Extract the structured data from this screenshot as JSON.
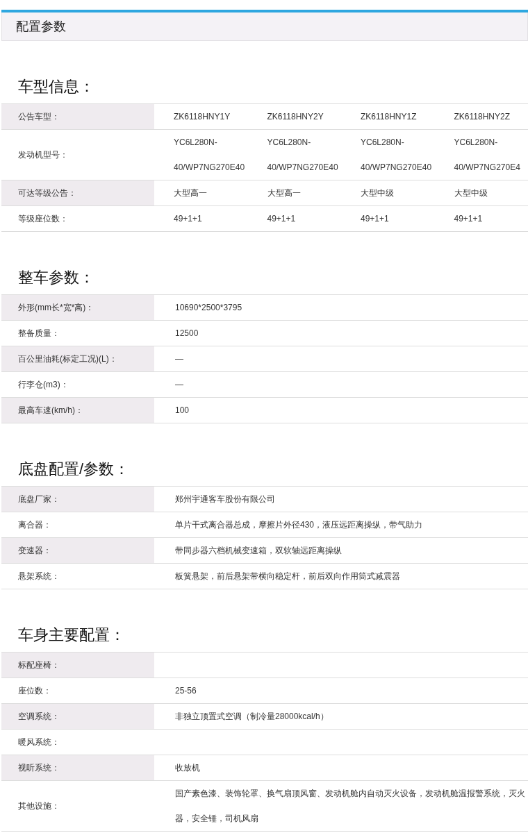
{
  "header": {
    "title": "配置参数"
  },
  "sections": [
    {
      "title": "车型信息：",
      "rows": [
        {
          "label": "公告车型：",
          "values": [
            "ZK6118HNY1Y",
            "ZK6118HNY2Y",
            "ZK6118HNY1Z",
            "ZK6118HNY2Z"
          ]
        },
        {
          "label": "发动机型号：",
          "values": [
            "YC6L280N-40/WP7NG270E40",
            "YC6L280N-40/WP7NG270E40",
            "YC6L280N-40/WP7NG270E40",
            "YC6L280N-40/WP7NG270E4"
          ]
        },
        {
          "label": "可达等级公告：",
          "values": [
            "大型高一",
            "大型高一",
            "大型中级",
            "大型中级"
          ]
        },
        {
          "label": "等级座位数：",
          "values": [
            "49+1+1",
            "49+1+1",
            "49+1+1",
            "49+1+1"
          ]
        }
      ]
    },
    {
      "title": "整车参数：",
      "rows": [
        {
          "label": "外形(mm长*宽*高)：",
          "values": [
            "10690*2500*3795"
          ]
        },
        {
          "label": "整备质量：",
          "values": [
            "12500"
          ]
        },
        {
          "label": "百公里油耗(标定工况)(L)：",
          "values": [
            "—"
          ]
        },
        {
          "label": "行李仓(m3)：",
          "values": [
            "—"
          ]
        },
        {
          "label": "最高车速(km/h)：",
          "values": [
            "100"
          ]
        }
      ]
    },
    {
      "title": "底盘配置/参数：",
      "rows": [
        {
          "label": "底盘厂家：",
          "values": [
            "郑州宇通客车股份有限公司"
          ]
        },
        {
          "label": "离合器：",
          "values": [
            "单片干式离合器总成，摩擦片外径430，液压远距离操纵，带气助力"
          ]
        },
        {
          "label": "变速器：",
          "values": [
            "带同步器六档机械变速箱，双软轴远距离操纵"
          ]
        },
        {
          "label": "悬架系统：",
          "values": [
            "板簧悬架，前后悬架带横向稳定杆，前后双向作用筒式减震器"
          ]
        }
      ]
    },
    {
      "title": "车身主要配置：",
      "rows": [
        {
          "label": "标配座椅："
        },
        {
          "label": "座位数：",
          "values": [
            "25-56"
          ]
        },
        {
          "label": "空调系统：",
          "values": [
            "非独立顶置式空调（制冷量28000kcal/h）"
          ]
        },
        {
          "label": "暖风系统："
        },
        {
          "label": "视听系统：",
          "values": [
            "收放机"
          ]
        },
        {
          "label": "其他设施：",
          "values": [
            "国产素色漆、装饰轮罩、换气扇顶风窗、发动机舱内自动灭火设备，发动机舱温报警系统，灭火器，安全锤，司机风扇"
          ]
        }
      ]
    }
  ]
}
